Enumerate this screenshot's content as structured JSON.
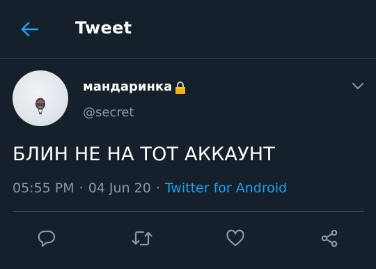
{
  "header": {
    "title": "Tweet",
    "back_icon": "arrow-left-icon",
    "accent_color": "#1da1f2"
  },
  "tweet": {
    "author": {
      "display_name": "мандаринка",
      "badge_icon": "lock-icon",
      "handle": "@secret"
    },
    "text": "БЛИН НЕ НА ТОТ АККАУНТ",
    "time": "05:55 PM",
    "date": "04 Jun 20",
    "source": "Twitter for Android",
    "separator": "·"
  },
  "actions": [
    {
      "icon": "reply-icon"
    },
    {
      "icon": "retweet-icon"
    },
    {
      "icon": "like-icon"
    },
    {
      "icon": "share-icon"
    }
  ],
  "colors": {
    "background": "#15202b",
    "secondary_text": "#8899a6",
    "divider": "#38444d"
  }
}
